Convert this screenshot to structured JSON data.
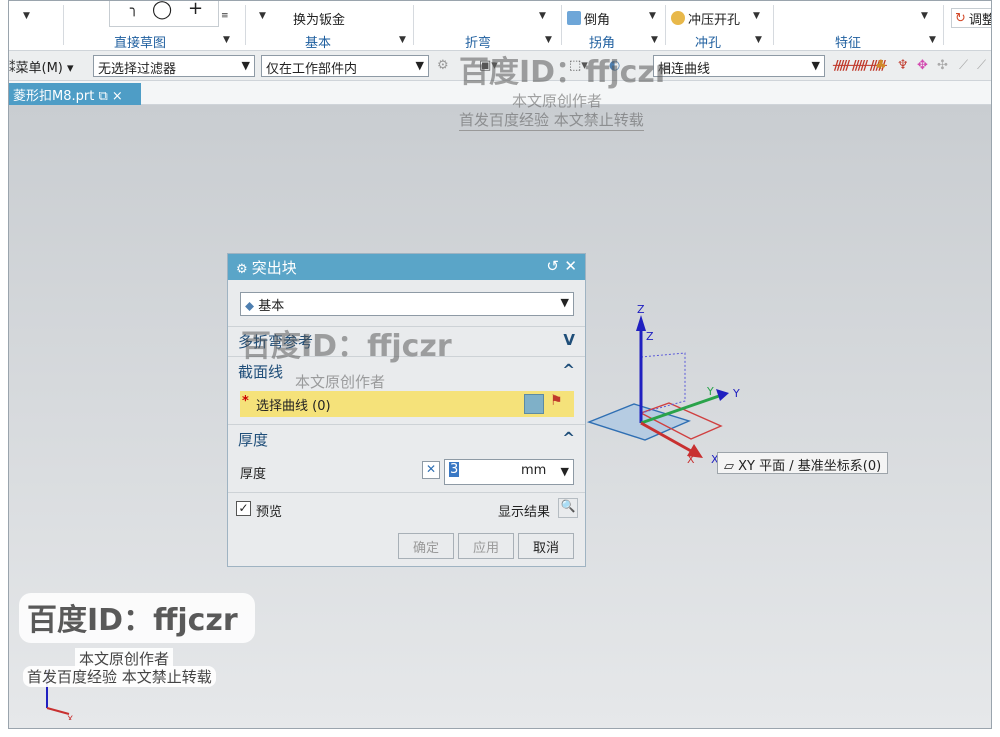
{
  "ribbon": {
    "groups": {
      "sketch": "直接草图",
      "basic": "基本",
      "bend": "折弯",
      "corner": "拐角",
      "punch": "冲孔",
      "feature": "特征"
    },
    "buttons": {
      "convert_sheet_metal": "换为钣金",
      "chamfer": "倒角",
      "stamped_hole": "冲压开孔",
      "adjust": "调整"
    }
  },
  "toolbar": {
    "menu": "菜单(M)",
    "filter": "无选择过滤器",
    "scope": "仅在工作部件内",
    "curve_rule": "相连曲线"
  },
  "tab": {
    "name": "菱形扣M8.prt"
  },
  "dialog": {
    "title": "突出块",
    "type_value": "基本",
    "sections": {
      "multi_bend_ref": "多折弯参考",
      "section_curve": "截面线",
      "thickness": "厚度"
    },
    "select_curve": "选择曲线 (0)",
    "thickness_label": "厚度",
    "thickness_value": "3",
    "thickness_unit": "mm",
    "preview": "预览",
    "show_result": "显示结果",
    "ok": "确定",
    "apply": "应用",
    "cancel": "取消"
  },
  "tooltip": {
    "text": "XY 平面 / 基准坐标系(0)"
  },
  "axes": {
    "x": "X",
    "y": "Y",
    "z": "Z"
  },
  "watermarks": {
    "id": "百度ID：ffjczr",
    "author": "本文原创作者",
    "notice": "首发百度经验  本文禁止转载"
  },
  "colors": {
    "title_bar": "#5aa5c8",
    "tab_active": "#4e9dc6",
    "highlight": "#f5e27a",
    "section_text": "#1f4e79"
  }
}
